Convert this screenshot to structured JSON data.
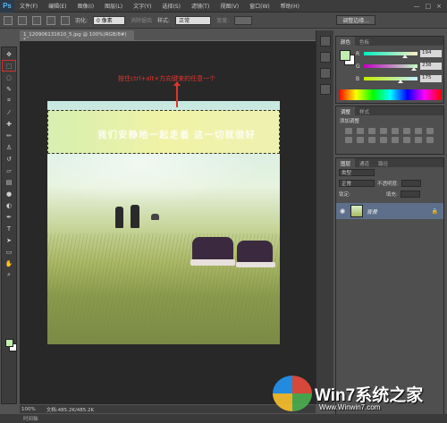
{
  "app": {
    "logo": "Ps"
  },
  "menu": [
    "文件(F)",
    "编辑(E)",
    "图像(I)",
    "图层(L)",
    "文字(Y)",
    "选择(S)",
    "滤镜(T)",
    "视图(V)",
    "窗口(W)",
    "帮助(H)"
  ],
  "window_controls": [
    "—",
    "□",
    "×"
  ],
  "options": {
    "feather_label": "羽化:",
    "feather_value": "0 像素",
    "antialias_label": "消除锯齿",
    "style_label": "样式:",
    "style_value": "正常",
    "width_label": "宽度:",
    "refine_edge_button": "调整边缘..."
  },
  "document": {
    "tab_title": "1_120906131610_5.jpg @ 100%(RGB/8#) *",
    "photo_caption": "我们安静地一起走着    这一切就很好",
    "annotation": "按住ctrl+alt+方向键来的任意一个"
  },
  "tools": [
    "move",
    "marquee",
    "lasso",
    "quick-select",
    "crop",
    "eyedropper",
    "spot-heal",
    "brush",
    "clone-stamp",
    "history-brush",
    "eraser",
    "gradient",
    "blur",
    "dodge",
    "pen",
    "type",
    "path-select",
    "shape",
    "hand",
    "zoom"
  ],
  "color_panel": {
    "tabs": [
      "颜色",
      "色板"
    ],
    "channels": [
      {
        "label": "R",
        "value": "194",
        "gradient": "linear-gradient(90deg,#00eec2,#ffeec2)",
        "level": 0.76
      },
      {
        "label": "G",
        "value": "238",
        "gradient": "linear-gradient(90deg,#c200c2,#c2ffc2)",
        "level": 0.93
      },
      {
        "label": "B",
        "value": "175",
        "gradient": "linear-gradient(90deg,#c2ee00,#c2eeff)",
        "level": 0.69
      }
    ],
    "foreground": "#c2eeaf"
  },
  "adjust_panel": {
    "tabs": [
      "调整",
      "样式"
    ],
    "title": "添加调整"
  },
  "layers_panel": {
    "tabs": [
      "图层",
      "通道",
      "路径"
    ],
    "kind_label": "类型",
    "blend_mode": "正常",
    "opacity_label": "不透明度:",
    "lock_label": "锁定:",
    "fill_label": "填充:",
    "layer_name": "背景"
  },
  "status": {
    "zoom": "100%",
    "doc_size": "文档:485.2K/485.2K"
  },
  "bottom_strip": {
    "label": "时间轴"
  },
  "watermark": {
    "text": "Win7系统之家",
    "url": "Www.Winwin7.com"
  }
}
